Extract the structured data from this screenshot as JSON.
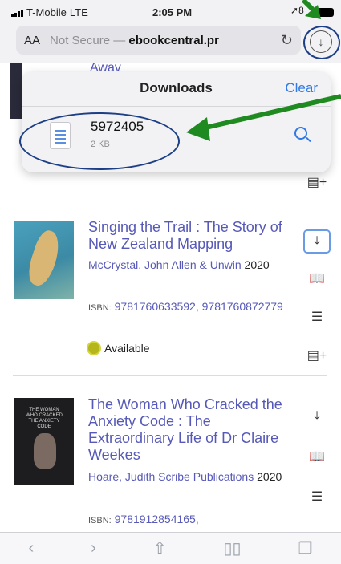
{
  "status_bar": {
    "carrier": "T-Mobile",
    "network": "LTE",
    "time": "2:05 PM",
    "location_text": "8"
  },
  "address_bar": {
    "aa": "AA",
    "not_secure": "Not Secure —",
    "url": "ebookcentral.pr"
  },
  "downloads": {
    "title": "Downloads",
    "clear_label": "Clear",
    "file": {
      "name": "5972405",
      "size": "2 KB"
    }
  },
  "books": [
    {
      "title_partial": "Awav"
    },
    {
      "title": "Singing the Trail : The Story of New Zealand Mapping",
      "authors_publisher": "McCrystal, John  Allen & Unwin",
      "year": "2020",
      "isbn_label": "ISBN:",
      "isbns": "9781760633592, 9781760872779",
      "availability": "Available",
      "cover_text": ""
    },
    {
      "title": "The Woman Who Cracked the Anxiety Code : The Extraordinary Life of Dr Claire Weekes",
      "authors_publisher": "Hoare, Judith  Scribe Publications",
      "year": "2020",
      "isbn_label": "ISBN:",
      "isbns": "9781912854165,",
      "cover_text": "THE WOMAN WHO CRACKED THE ANXIETY CODE"
    }
  ],
  "icons": {
    "download": "download-icon",
    "read": "book-icon",
    "toc": "list-icon",
    "add": "add-to-list-icon"
  },
  "colors": {
    "link": "#5659b8",
    "accent": "#2f7ae5",
    "annotation_arrow": "#1f8a1f",
    "annotation_ring": "#1d3f86"
  }
}
